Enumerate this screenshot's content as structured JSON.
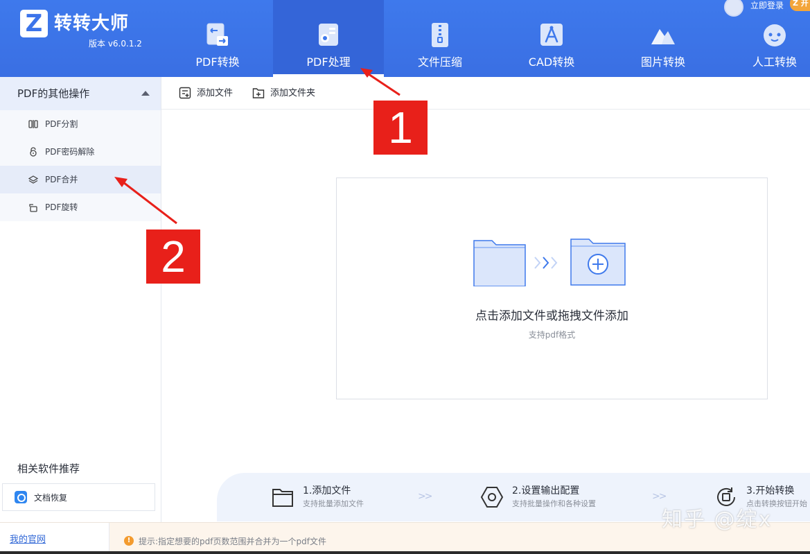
{
  "app": {
    "name": "转转大师",
    "logo_letter": "Z",
    "version": "版本 v6.0.1.2"
  },
  "account": {
    "login_label": "立即登录",
    "badge": "Z 开"
  },
  "nav": {
    "items": [
      {
        "label": "PDF转换",
        "icon": "pdf-convert-icon"
      },
      {
        "label": "PDF处理",
        "icon": "pdf-process-icon",
        "active": true
      },
      {
        "label": "文件压缩",
        "icon": "zip-icon"
      },
      {
        "label": "CAD转换",
        "icon": "cad-icon"
      },
      {
        "label": "图片转换",
        "icon": "image-icon"
      },
      {
        "label": "人工转换",
        "icon": "robot-icon"
      }
    ]
  },
  "sidebar": {
    "section_title": "PDF的其他操作",
    "items": [
      {
        "label": "PDF分割",
        "icon": "split-icon"
      },
      {
        "label": "PDF密码解除",
        "icon": "unlock-icon"
      },
      {
        "label": "PDF合并",
        "icon": "layers-icon",
        "active": true
      },
      {
        "label": "PDF旋转",
        "icon": "rotate-icon"
      }
    ],
    "related_title": "相关软件推荐",
    "related_items": [
      {
        "label": "文档恢复",
        "icon": "recovery-icon"
      }
    ]
  },
  "toolbar": {
    "add_file": "添加文件",
    "add_folder": "添加文件夹"
  },
  "dropzone": {
    "main_text": "点击添加文件或拖拽文件添加",
    "sub_text": "支持pdf格式"
  },
  "steps": [
    {
      "title": "1.添加文件",
      "sub": "支持批量添加文件"
    },
    {
      "title": "2.设置输出配置",
      "sub": "支持批量操作和各种设置"
    },
    {
      "title": "3.开始转换",
      "sub": "点击转换按钮开始"
    }
  ],
  "statusbar": {
    "site_link": "我的官网",
    "tip_icon": "!",
    "tip": "提示:指定想要的pdf页数范围并合并为一个pdf文件"
  },
  "annotations": {
    "callout_1": "1",
    "callout_2": "2"
  },
  "watermark": "知乎 @绽x",
  "colors": {
    "header_blue": "#3e79ec",
    "accent_red": "#e8201a",
    "tip_orange": "#f39b2f"
  }
}
